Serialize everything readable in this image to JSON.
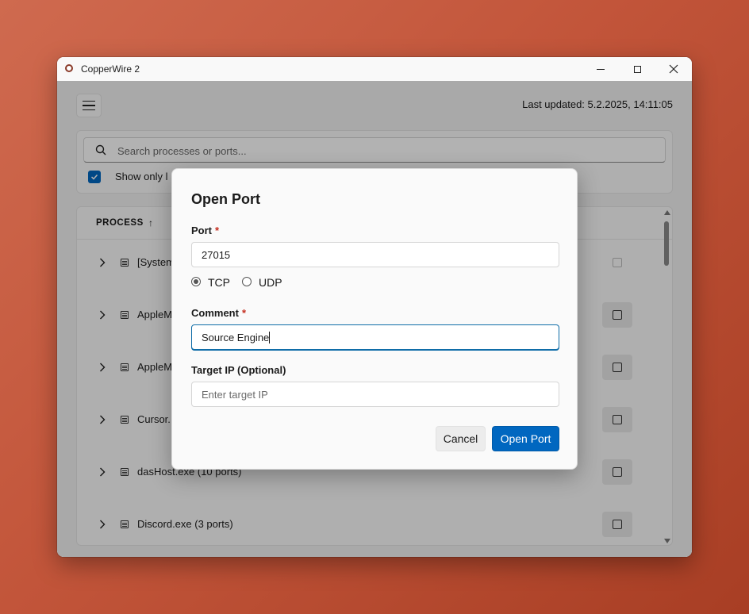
{
  "window": {
    "title": "CopperWire 2",
    "controls": [
      "minimize-icon",
      "maximize-icon",
      "close-icon"
    ]
  },
  "header": {
    "last_updated": "Last updated: 5.2.2025, 14:11:05"
  },
  "search": {
    "placeholder": "Search processes or ports...",
    "filter_label": "Show only l",
    "filter_checked": true
  },
  "table": {
    "column_process": "PROCESS",
    "sort_indicator": "↑",
    "rows": [
      {
        "name": "[System"
      },
      {
        "name": "AppleM"
      },
      {
        "name": "AppleM"
      },
      {
        "name": "Cursor."
      },
      {
        "name": "dasHost.exe  (10 ports)"
      },
      {
        "name": "Discord.exe  (3 ports)"
      }
    ]
  },
  "dialog": {
    "title": "Open Port",
    "port_label": "Port",
    "required_mark": "*",
    "port_value": "27015",
    "protocols": [
      "TCP",
      "UDP"
    ],
    "selected_protocol": "TCP",
    "comment_label": "Comment",
    "comment_value": "Source Engine",
    "target_ip_label": "Target IP (Optional)",
    "target_ip_placeholder": "Enter target IP",
    "cancel_label": "Cancel",
    "confirm_label": "Open Port"
  },
  "colors": {
    "accent": "#0067c0",
    "required": "#c42b1c",
    "background": "#c2553a"
  }
}
